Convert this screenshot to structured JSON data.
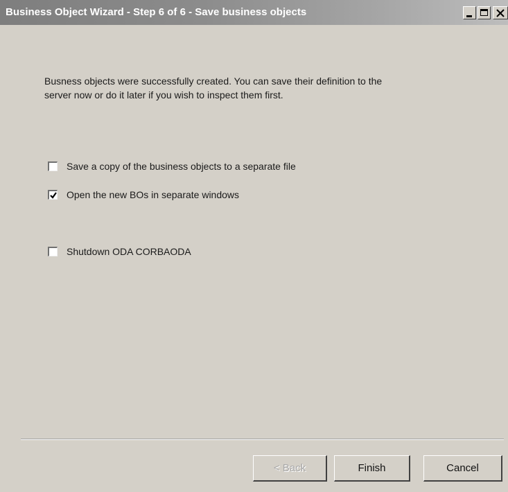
{
  "window": {
    "title": "Business Object Wizard - Step 6 of 6 - Save business objects"
  },
  "message": "Busness objects were successfully created. You can save their definition to the\nserver now or do it later if you wish to inspect them first.",
  "options": {
    "save_copy": {
      "label": "Save a copy of the business objects to a separate file",
      "checked": false
    },
    "open_new": {
      "label": "Open the new BOs in separate windows",
      "checked": true
    },
    "shutdown": {
      "label": "Shutdown ODA CORBAODA",
      "checked": false
    }
  },
  "buttons": {
    "back": {
      "label": "< Back",
      "enabled": false
    },
    "finish": {
      "label": "Finish",
      "enabled": true
    },
    "cancel": {
      "label": "Cancel",
      "enabled": true
    }
  },
  "colors": {
    "dialog_bg": "#d4d0c8",
    "title_text": "#ffffff",
    "disabled_text": "#a8a8a8"
  }
}
